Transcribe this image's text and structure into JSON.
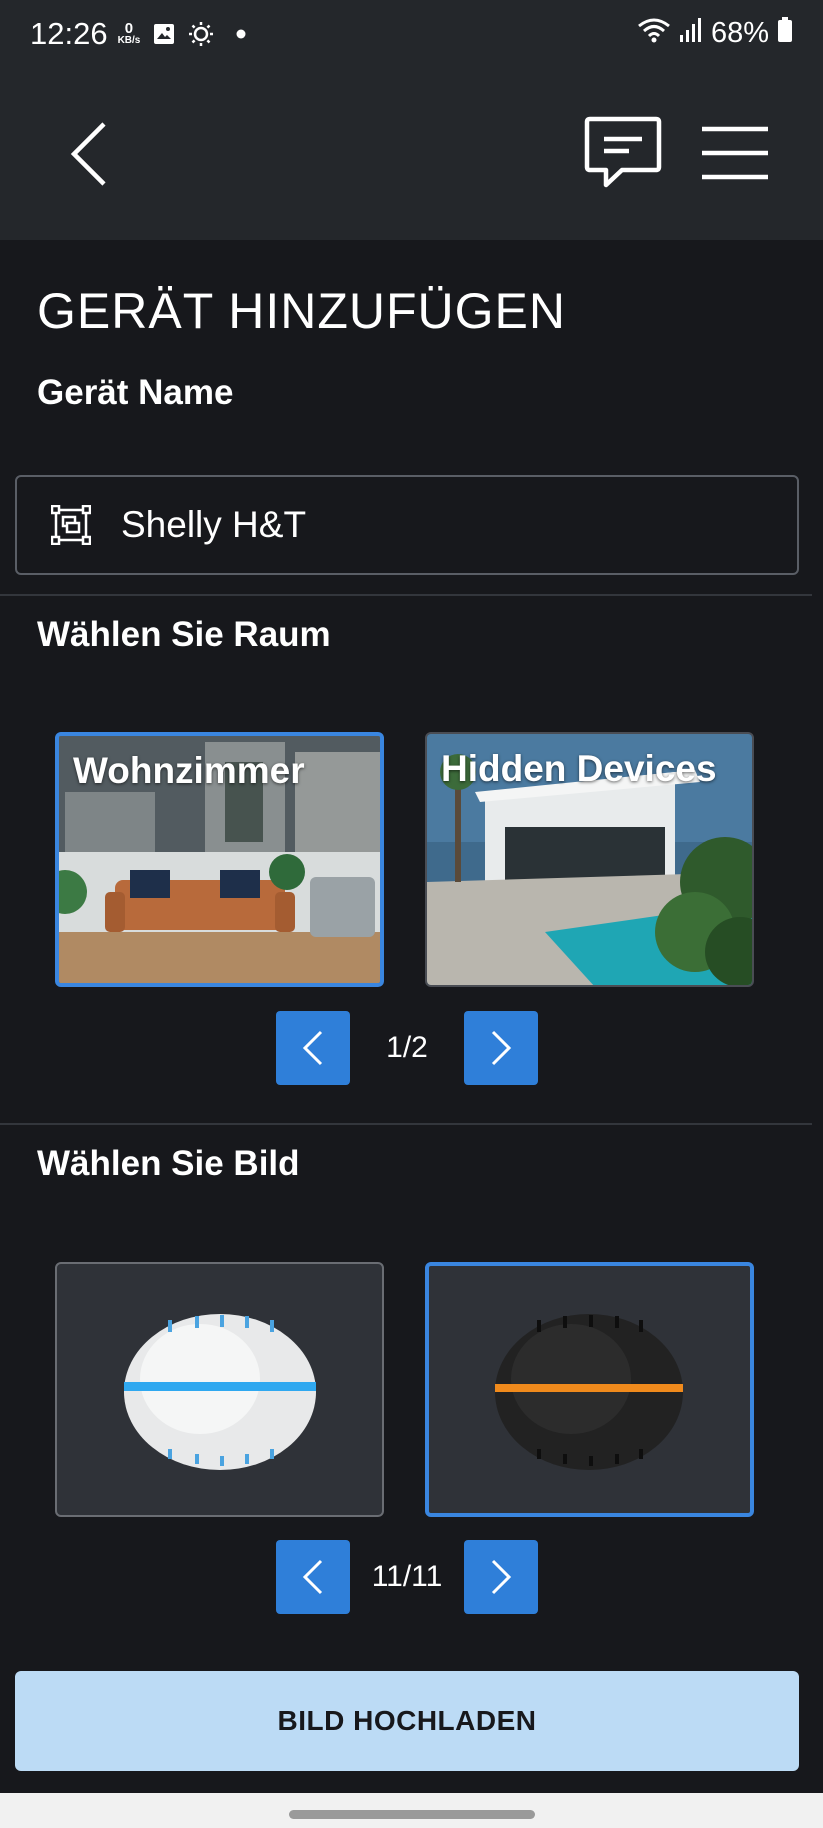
{
  "status_bar": {
    "time": "12:26",
    "net_speed_value": "0",
    "net_speed_unit": "KB/s",
    "battery": "68%"
  },
  "header": {
    "back_icon": "chevron-left-icon",
    "chat_icon": "chat-bubble-icon",
    "menu_icon": "hamburger-menu-icon"
  },
  "page": {
    "title": "GERÄT HINZUFÜGEN",
    "name_label": "Gerät Name",
    "name_value": "Shelly H&T",
    "room_label": "Wählen Sie Raum",
    "image_label": "Wählen Sie Bild",
    "upload_label": "BILD HOCHLADEN"
  },
  "rooms": {
    "items": [
      {
        "label": "Wohnzimmer",
        "selected": true
      },
      {
        "label": "Hidden Devices",
        "selected": false
      }
    ],
    "page_indicator": "1/2"
  },
  "images": {
    "items": [
      {
        "name": "sensor-white",
        "accent": "#2fa8f0",
        "selected": false
      },
      {
        "name": "sensor-black",
        "accent": "#f08a1c",
        "selected": true
      }
    ],
    "page_indicator": "11/11"
  },
  "colors": {
    "accent_blue": "#2f7fd9",
    "upload_bg": "#bcdbf5",
    "bg": "#17181c",
    "header_bg": "#24272b"
  }
}
